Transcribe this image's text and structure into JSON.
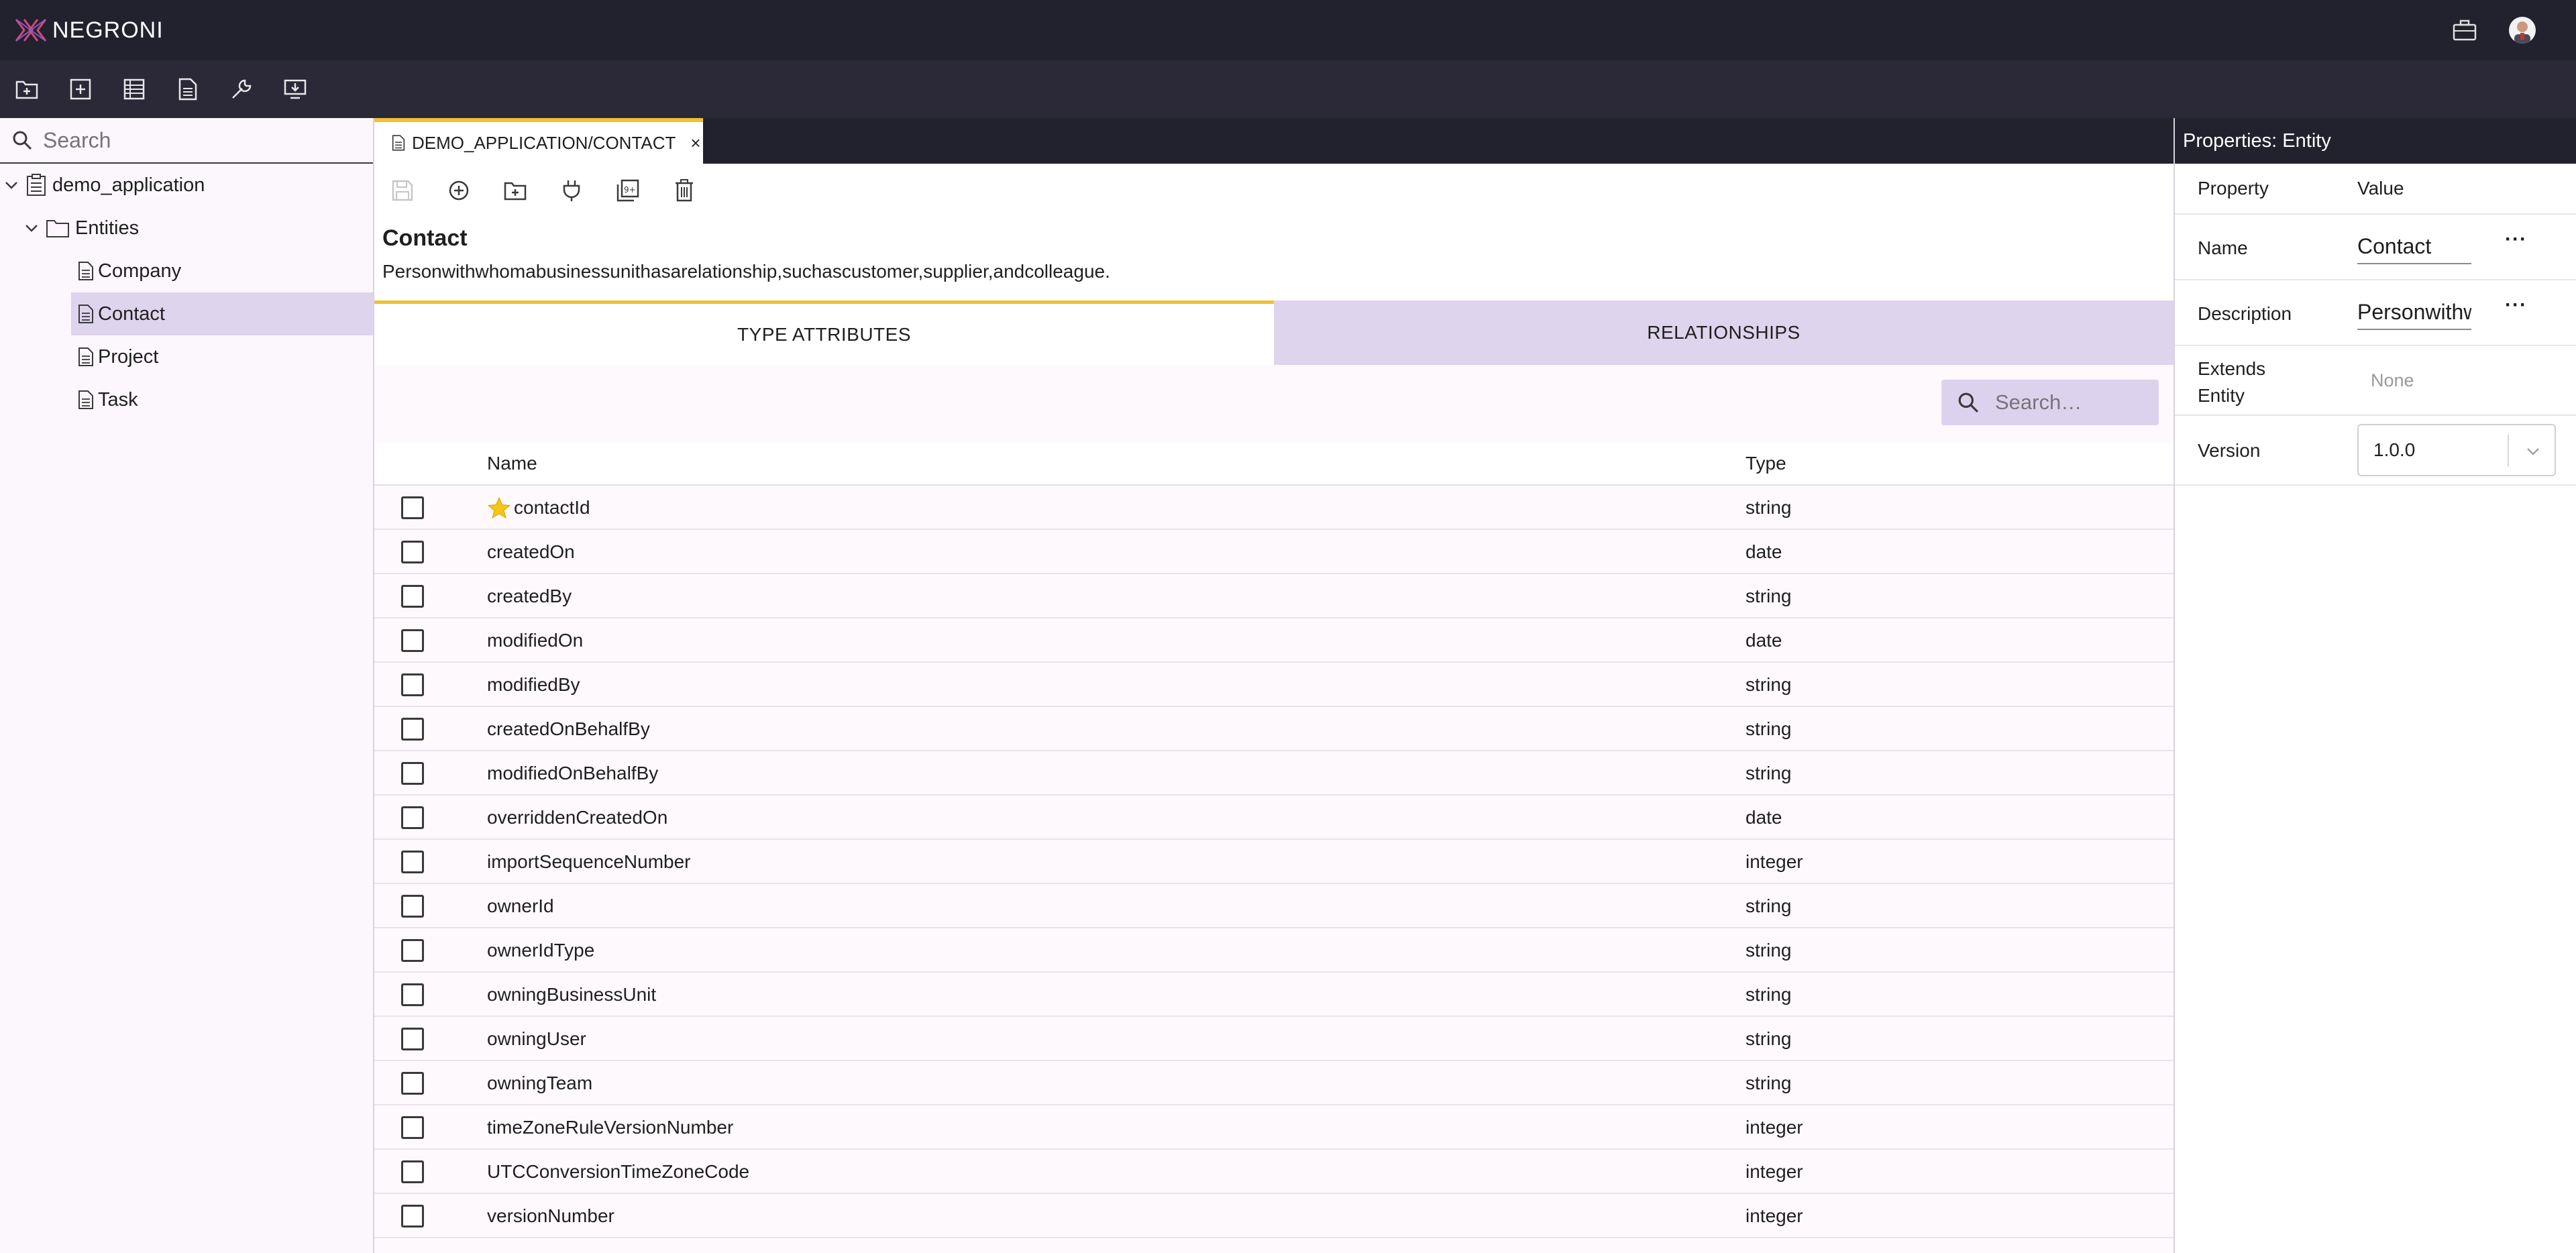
{
  "app": {
    "brand": "NEGRONI"
  },
  "toolbar": {
    "buttons": [
      "new-folder-icon",
      "add-icon",
      "table-icon",
      "document-icon",
      "wrench-icon",
      "deploy-icon"
    ]
  },
  "sidebar": {
    "search_placeholder": "Search",
    "tree": {
      "root": "demo_application",
      "folder": "Entities",
      "items": [
        "Company",
        "Contact",
        "Project",
        "Task"
      ],
      "selected": "Contact"
    }
  },
  "editor": {
    "tab_label": "DEMO_APPLICATION/CONTACT",
    "tab_close": "×",
    "entity_name": "Contact",
    "entity_description": "Personwithwhomabusinessunithasarelationship,suchascustomer,supplier,andcolleague.",
    "subtabs": {
      "attributes": "TYPE ATTRIBUTES",
      "relationships": "RELATIONSHIPS"
    },
    "grid_search_placeholder": "Search…",
    "columns": {
      "name": "Name",
      "type": "Type"
    },
    "rows": [
      {
        "name": "contactId",
        "type": "string",
        "key": true
      },
      {
        "name": "createdOn",
        "type": "date"
      },
      {
        "name": "createdBy",
        "type": "string"
      },
      {
        "name": "modifiedOn",
        "type": "date"
      },
      {
        "name": "modifiedBy",
        "type": "string"
      },
      {
        "name": "createdOnBehalfBy",
        "type": "string"
      },
      {
        "name": "modifiedOnBehalfBy",
        "type": "string"
      },
      {
        "name": "overriddenCreatedOn",
        "type": "date"
      },
      {
        "name": "importSequenceNumber",
        "type": "integer"
      },
      {
        "name": "ownerId",
        "type": "string"
      },
      {
        "name": "ownerIdType",
        "type": "string"
      },
      {
        "name": "owningBusinessUnit",
        "type": "string"
      },
      {
        "name": "owningUser",
        "type": "string"
      },
      {
        "name": "owningTeam",
        "type": "string"
      },
      {
        "name": "timeZoneRuleVersionNumber",
        "type": "integer"
      },
      {
        "name": "UTCConversionTimeZoneCode",
        "type": "integer"
      },
      {
        "name": "versionNumber",
        "type": "integer"
      }
    ]
  },
  "properties": {
    "header": "Properties: Entity",
    "col_property": "Property",
    "col_value": "Value",
    "name_label": "Name",
    "name_value": "Contact",
    "description_label": "Description",
    "description_value": "Personwithwhomabusinessunithasarelationship,suchascustomer,supplier,andcolleague.",
    "extends_label_1": "Extends",
    "extends_label_2": "Entity",
    "extends_value": "None",
    "version_label": "Version",
    "version_value": "1.0.0",
    "ellipsis": "···"
  },
  "colors": {
    "header_bg": "#22212e",
    "toolbar_bg": "#2b2838",
    "accent_yellow": "#f0c030",
    "lavender": "#ded4ed",
    "logo_pink": "#d04a7a",
    "star": "#f5c518"
  }
}
